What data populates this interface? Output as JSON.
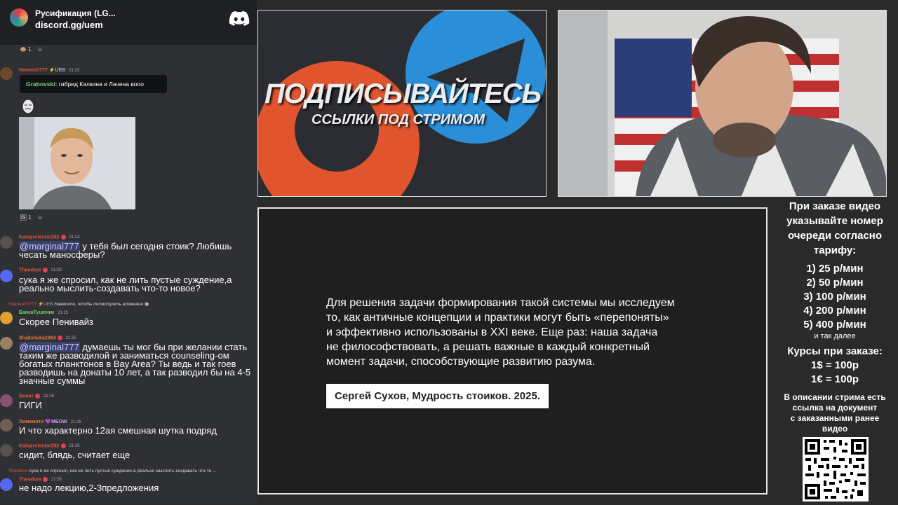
{
  "chat_header": {
    "server_name": "Русификация (LG...",
    "invite": "discord.gg/uem"
  },
  "messages": {
    "r1": {
      "count": "1"
    },
    "m1": {
      "user": "Haneech777",
      "tags": "⚡UEB",
      "time": "21:23",
      "embed_author": "Grabovski:",
      "embed_text": " гибрид Калкина и Лачена вооо"
    },
    "r2": {
      "count": "1"
    },
    "m2": {
      "user": "Kaloprotector282",
      "time": "21:24",
      "mention": "@marginal777",
      "text": " у тебя был сегодня стоик? Любишь",
      "text2": "чесать маносферы?"
    },
    "m3": {
      "user": "Theodore",
      "time": "21:25",
      "text": "сука я же спросил, как не лить пустые суждение,а",
      "text2": "реально мыслить-создавать что-то новое?"
    },
    "m4reply": {
      "user": "Shaneech777",
      "tags": "⚡UEB",
      "hint": "Нажмите, чтобы посмотреть вложение"
    },
    "m4": {
      "user": "БанкаТушенки",
      "time": "21:25",
      "text": "Скорее Пенивайз"
    },
    "m5": {
      "user": "Shakshuka1984",
      "time": "21:25",
      "mention": "@marginal777",
      "text": " думаешь ты мог бы при желании стать",
      "text2": "таким же разводилой и заниматься counseling-ом",
      "text3": "богатых планктонов в Bay Area? Ты ведь и так гоев",
      "text4": "разводишь на донаты 10 лет, а так разводил бы на 4-5",
      "text5": "значные суммы"
    },
    "m6": {
      "user": "Вевит",
      "time": "21:26",
      "text": "ГИГИ"
    },
    "m7": {
      "user": "Лимамити",
      "tags": "💜MEOW",
      "time": "21:26",
      "text": "И что характерно 12ая смешная шутка подряд"
    },
    "m8": {
      "user": "Kaloprotector282",
      "time": "21:26",
      "text": "сидит, блядь, считает еще"
    },
    "m9reply": {
      "user": "Theodore",
      "text": "сука я же спросил, как не лить пустые суждение,а реально мыслить-создавать что-то ..."
    },
    "m9": {
      "user": "Theodore",
      "time": "21:26",
      "text": "не надо лекцию,2-3предложения"
    }
  },
  "promo": {
    "line1": "ПОДПИСЫВАЙТЕСЬ",
    "line2": "ССЫЛКИ ПОД СТРИМОМ"
  },
  "quote": {
    "lines": [
      "Для решения задачи формирования такой системы мы исследуем",
      "то, как античные концепции и практики могут быть «перепоняты»",
      "и эффективно использованы в XXI веке. Еще раз: наша задача",
      "не философствовать, а решать важные в каждый конкретный",
      "момент задачи, способствующие развитию разума."
    ],
    "citation": "Сергей Сухов, Мудрость стоиков. 2025."
  },
  "sidebar": {
    "intro": [
      "При заказе видео",
      "указывайте номер",
      "очереди согласно",
      "тарифу:"
    ],
    "tariffs": [
      "1) 25 р/мин",
      "2) 50 р/мин",
      "3) 100 р/мин",
      "4) 200 р/мин",
      "5) 400 р/мин"
    ],
    "etc": "и так далее",
    "courses_title": "Курсы при заказе:",
    "courses": [
      "1$ = 100р",
      "1€ = 100р"
    ],
    "note": [
      "В описании стрима есть",
      "ссылка на документ",
      "с заказанными ранее",
      "видео"
    ]
  }
}
